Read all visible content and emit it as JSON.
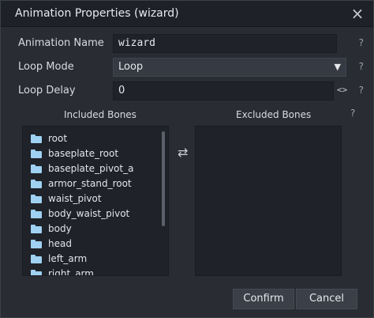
{
  "window": {
    "title": "Animation Properties (wizard)",
    "close_glyph": "×"
  },
  "fields": {
    "name": {
      "label": "Animation Name",
      "value": "wizard",
      "help": "?"
    },
    "loop_mode": {
      "label": "Loop Mode",
      "value": "Loop",
      "help": "?"
    },
    "loop_delay": {
      "label": "Loop Delay",
      "value": "0",
      "stepper": "<>",
      "help": "?"
    }
  },
  "bones": {
    "included_title": "Included Bones",
    "excluded_title": "Excluded Bones",
    "help": "?",
    "included": [
      "root",
      "baseplate_root",
      "baseplate_pivot_a",
      "armor_stand_root",
      "waist_pivot",
      "body_waist_pivot",
      "body",
      "head",
      "left_arm",
      "right_arm"
    ],
    "excluded": [],
    "swap_icon": "⇄"
  },
  "buttons": {
    "confirm": "Confirm",
    "cancel": "Cancel"
  },
  "colors": {
    "folder": "#9fd1f2",
    "panel": "#292c33",
    "titlebar": "#1e2127"
  }
}
